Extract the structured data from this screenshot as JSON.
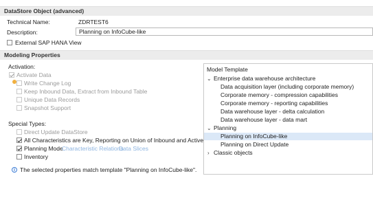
{
  "header1": {
    "title": "DataStore Object (advanced)"
  },
  "general": {
    "technical_name_label": "Technical Name:",
    "technical_name_value": "ZDRTEST6",
    "description_label": "Description:",
    "description_value": "Planning on InfoCube-like",
    "external_hana_view_label": "External SAP HANA View",
    "external_hana_view_checked": false
  },
  "header2": {
    "title": "Modeling Properties"
  },
  "activation": {
    "label": "Activation:",
    "options": [
      {
        "label": "Activate Data",
        "checked": true,
        "enabled": false
      },
      {
        "label": "Write Change Log",
        "checked": false,
        "enabled": false
      },
      {
        "label": "Keep Inbound Data, Extract from Inbound Table",
        "checked": false,
        "enabled": false
      },
      {
        "label": "Unique Data Records",
        "checked": false,
        "enabled": false
      },
      {
        "label": "Snapshot Support",
        "checked": false,
        "enabled": false
      }
    ]
  },
  "special_types": {
    "label": "Special Types:",
    "options": [
      {
        "label": "Direct Update DataStore",
        "checked": false,
        "enabled": false
      },
      {
        "label": "All Characteristics are Key, Reporting on Union of Inbound and Active Table",
        "checked": true,
        "enabled": true
      },
      {
        "label": "Planning Mode",
        "checked": true,
        "enabled": true
      },
      {
        "label": "Inventory",
        "checked": false,
        "enabled": true
      }
    ],
    "link_characteristic_relations": "Characteristic Relations",
    "link_data_slices": "Data Slices"
  },
  "model_template": {
    "title": "Model Template",
    "tree": [
      {
        "label": "Enterprise data warehouse architecture",
        "expanded": true,
        "level": 0
      },
      {
        "label": "Data acquisition layer (including corporate memory)",
        "level": 1
      },
      {
        "label": "Corporate memory - compression capabilities",
        "level": 1
      },
      {
        "label": "Corporate memory - reporting capabilities",
        "level": 1
      },
      {
        "label": "Data warehouse layer - delta calculation",
        "level": 1
      },
      {
        "label": "Data warehouse layer - data mart",
        "level": 1
      },
      {
        "label": "Planning",
        "expanded": true,
        "level": 0
      },
      {
        "label": "Planning on InfoCube-like",
        "level": 1,
        "selected": true
      },
      {
        "label": "Planning on Direct Update",
        "level": 1
      },
      {
        "label": "Classic objects",
        "expanded": false,
        "level": 0
      }
    ]
  },
  "info": {
    "message": "The selected properties match template \"Planning on InfoCube-like\"."
  }
}
